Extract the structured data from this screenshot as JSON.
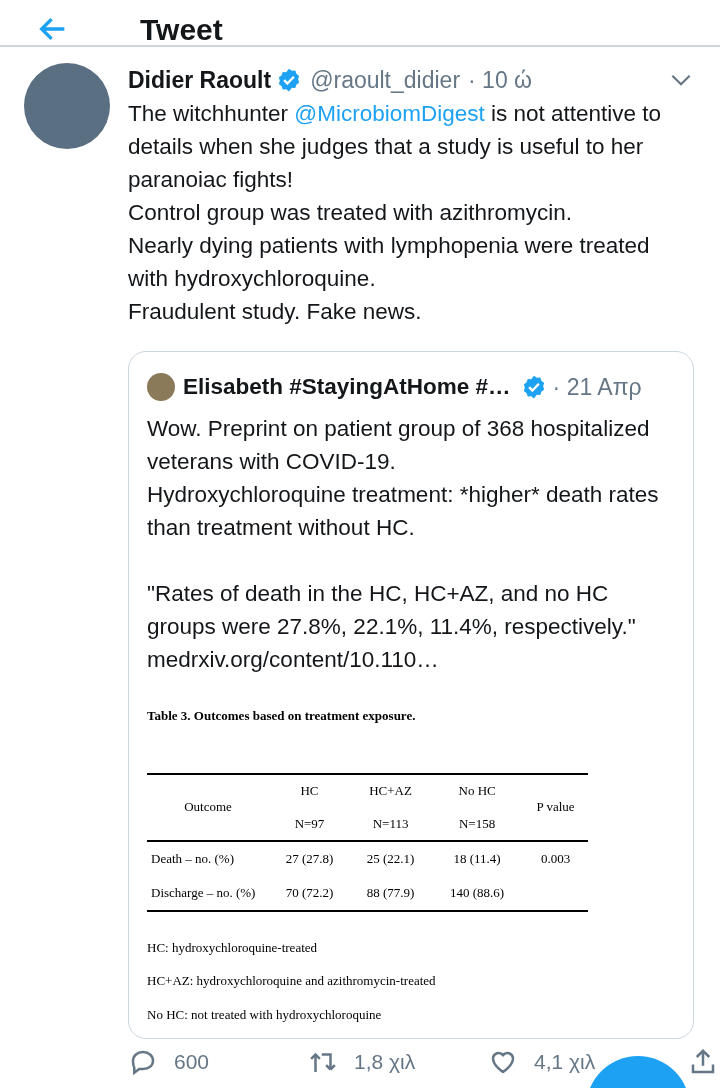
{
  "header": {
    "title": "Tweet"
  },
  "tweet": {
    "author": "Didier Raoult",
    "verified": true,
    "handle": "@raoult_didier",
    "time": "· 10 ώ",
    "body": [
      {
        "kind": "text",
        "text": "The witchhunter "
      },
      {
        "kind": "mention",
        "text": "@MicrobiomDigest"
      },
      {
        "kind": "text",
        "text": " is not attentive to details when she judges that a study is useful to her paranoiac fights!\nControl group was treated with azithromycin.\nNearly dying patients with lymphopenia were treated with hydroxychloroquine.\nFraudulent study. Fake news."
      }
    ]
  },
  "quote": {
    "author": "Elisabeth #StayingAtHome #…",
    "verified": true,
    "time": "· 21 Απρ",
    "body": "Wow. Preprint on patient group of 368 hospitalized veterans with COVID-19.\nHydroxychloroquine treatment:  *higher* death rates than treatment without HC.\n\n\"Rates of death in the HC, HC+AZ, and no HC groups were 27.8%, 22.1%, 11.4%, respectively.\"",
    "link": "medrxiv.org/content/10.110…",
    "document": {
      "title": "Table 3. Outcomes based on treatment exposure.",
      "columns": [
        {
          "name": "Outcome"
        },
        {
          "name": "HC",
          "n": "N=97"
        },
        {
          "name": "HC+AZ",
          "n": "N=113"
        },
        {
          "name": "No HC",
          "n": "N=158"
        },
        {
          "name": "P value"
        }
      ],
      "rows": [
        [
          "Death – no. (%)",
          "27 (27.8)",
          "25 (22.1)",
          "18 (11.4)",
          "0.003"
        ],
        [
          "Discharge – no. (%)",
          "70 (72.2)",
          "88 (77.9)",
          "140 (88.6)",
          ""
        ]
      ],
      "notes": [
        "HC: hydroxychloroquine-treated",
        "HC+AZ: hydroxychloroquine and azithromycin-treated",
        "No HC: not treated with hydroxychloroquine"
      ]
    }
  },
  "actions": [
    {
      "kind": "reply",
      "count": "600"
    },
    {
      "kind": "retweet",
      "count": "1,8 χιλ"
    },
    {
      "kind": "like",
      "count": "4,1 χιλ"
    },
    {
      "kind": "share"
    }
  ]
}
